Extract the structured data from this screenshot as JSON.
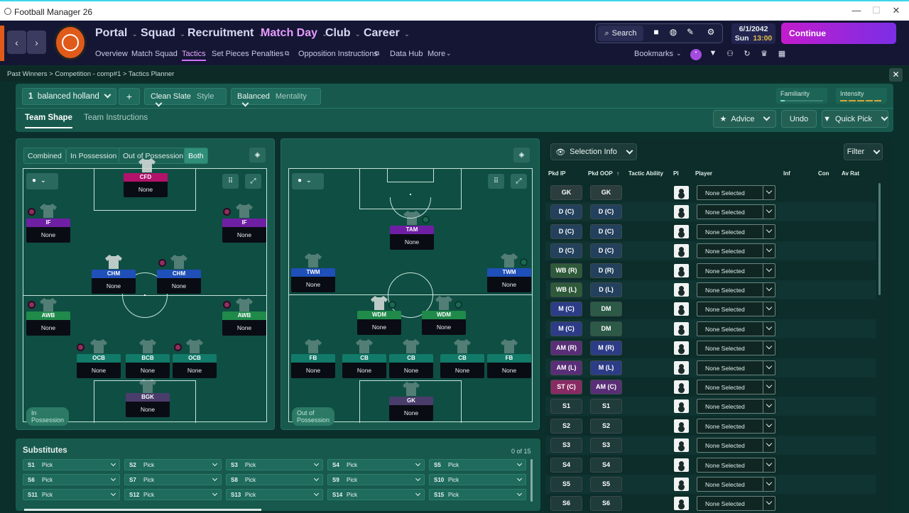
{
  "window": {
    "title": "Football Manager 26",
    "min": "—",
    "max": "☐",
    "close": "✕"
  },
  "nav": {
    "back": "‹",
    "forward": "›",
    "main": [
      "Portal",
      "Squad",
      "Recruitment",
      "Match Day",
      "Club",
      "Career"
    ],
    "sub": [
      "Overview",
      "Match Squad",
      "Tactics",
      "Set Pieces",
      "Penalties",
      "Opposition Instructions",
      "Data Hub",
      "More"
    ],
    "active_main": "Match Day",
    "active_sub": "Tactics",
    "search": "Search",
    "date_line1": "6/1/2042",
    "date_day": "Sun",
    "date_time": "13:00",
    "continue": "Continue",
    "bookmarks": "Bookmarks"
  },
  "breadcrumb": [
    "Past Winners",
    "Competition - comp#1",
    "Tactics Planner"
  ],
  "toolbar": {
    "tactic_num": "1",
    "tactic_name": "balanced holland",
    "add": "+",
    "style_value": "Clean Slate",
    "style_label": "Style",
    "mentality_value": "Balanced",
    "mentality_label": "Mentality",
    "familiarity": "Familiarity",
    "intensity": "Intensity",
    "tabs": [
      "Team Shape",
      "Team Instructions"
    ],
    "advice": "Advice",
    "undo": "Undo",
    "quick_pick": "Quick Pick"
  },
  "modes": [
    "Combined",
    "In Possession",
    "Out of Possession",
    "Both"
  ],
  "in_possession": {
    "label": "In Possession",
    "players": [
      {
        "role": "CFD",
        "name": "None",
        "color": "#b3126a"
      },
      {
        "role": "IF",
        "name": "None",
        "color": "#6f1fa3"
      },
      {
        "role": "IF",
        "name": "None",
        "color": "#6f1fa3"
      },
      {
        "role": "CHM",
        "name": "None",
        "color": "#1f4fb8"
      },
      {
        "role": "CHM",
        "name": "None",
        "color": "#1f4fb8"
      },
      {
        "role": "AWB",
        "name": "None",
        "color": "#1f8a4a"
      },
      {
        "role": "AWB",
        "name": "None",
        "color": "#1f8a4a"
      },
      {
        "role": "OCB",
        "name": "None",
        "color": "#127a69"
      },
      {
        "role": "BCB",
        "name": "None",
        "color": "#127a69"
      },
      {
        "role": "OCB",
        "name": "None",
        "color": "#127a69"
      },
      {
        "role": "BGK",
        "name": "None",
        "color": "#4a3d6b"
      }
    ]
  },
  "out_possession": {
    "label": "Out of Possession",
    "players": [
      {
        "role": "TAM",
        "name": "None",
        "color": "#6f1fa3"
      },
      {
        "role": "TWM",
        "name": "None",
        "color": "#1f4fb8"
      },
      {
        "role": "TWM",
        "name": "None",
        "color": "#1f4fb8"
      },
      {
        "role": "WDM",
        "name": "None",
        "color": "#1f8a4a"
      },
      {
        "role": "WDM",
        "name": "None",
        "color": "#1f8a4a"
      },
      {
        "role": "FB",
        "name": "None",
        "color": "#127a69"
      },
      {
        "role": "CB",
        "name": "None",
        "color": "#127a69"
      },
      {
        "role": "CB",
        "name": "None",
        "color": "#127a69"
      },
      {
        "role": "CB",
        "name": "None",
        "color": "#127a69"
      },
      {
        "role": "FB",
        "name": "None",
        "color": "#127a69"
      },
      {
        "role": "GK",
        "name": "None",
        "color": "#4a3d6b"
      }
    ]
  },
  "substitutes": {
    "title": "Substitutes",
    "count": "0 of 15",
    "slots": [
      {
        "id": "S1",
        "val": "Pick"
      },
      {
        "id": "S2",
        "val": "Pick"
      },
      {
        "id": "S3",
        "val": "Pick"
      },
      {
        "id": "S4",
        "val": "Pick"
      },
      {
        "id": "S5",
        "val": "Pick"
      },
      {
        "id": "S6",
        "val": "Pick"
      },
      {
        "id": "S7",
        "val": "Pick"
      },
      {
        "id": "S8",
        "val": "Pick"
      },
      {
        "id": "S9",
        "val": "Pick"
      },
      {
        "id": "S10",
        "val": "Pick"
      },
      {
        "id": "S11",
        "val": "Pick"
      },
      {
        "id": "S12",
        "val": "Pick"
      },
      {
        "id": "S13",
        "val": "Pick"
      },
      {
        "id": "S14",
        "val": "Pick"
      },
      {
        "id": "S15",
        "val": "Pick"
      }
    ]
  },
  "selection": {
    "info": "Selection Info",
    "filter": "Filter",
    "headers": [
      "Pkd IP",
      "Pkd OOP",
      "Tactic Ability",
      "PI",
      "Player",
      "Inf",
      "Con",
      "Av Rat"
    ],
    "rows": [
      {
        "ip": "GK",
        "oop": "GK",
        "player": "None Selected"
      },
      {
        "ip": "D (C)",
        "oop": "D (C)",
        "player": "None Selected"
      },
      {
        "ip": "D (C)",
        "oop": "D (C)",
        "player": "None Selected"
      },
      {
        "ip": "D (C)",
        "oop": "D (C)",
        "player": "None Selected"
      },
      {
        "ip": "WB (R)",
        "oop": "D (R)",
        "player": "None Selected"
      },
      {
        "ip": "WB (L)",
        "oop": "D (L)",
        "player": "None Selected"
      },
      {
        "ip": "M (C)",
        "oop": "DM",
        "player": "None Selected"
      },
      {
        "ip": "M (C)",
        "oop": "DM",
        "player": "None Selected"
      },
      {
        "ip": "AM (R)",
        "oop": "M (R)",
        "player": "None Selected"
      },
      {
        "ip": "AM (L)",
        "oop": "M (L)",
        "player": "None Selected"
      },
      {
        "ip": "ST (C)",
        "oop": "AM (C)",
        "player": "None Selected"
      },
      {
        "ip": "S1",
        "oop": "S1",
        "player": "None Selected"
      },
      {
        "ip": "S2",
        "oop": "S2",
        "player": "None Selected"
      },
      {
        "ip": "S3",
        "oop": "S3",
        "player": "None Selected"
      },
      {
        "ip": "S4",
        "oop": "S4",
        "player": "None Selected"
      },
      {
        "ip": "S5",
        "oop": "S5",
        "player": "None Selected"
      },
      {
        "ip": "S6",
        "oop": "S6",
        "player": "None Selected"
      }
    ]
  }
}
